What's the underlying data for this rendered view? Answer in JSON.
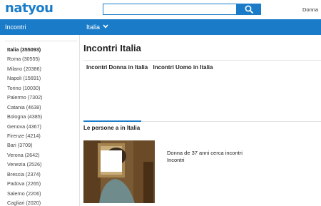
{
  "header": {
    "logo": "natyou",
    "search": {
      "value": "",
      "placeholder": ""
    },
    "user_link": "Donna"
  },
  "navbar": {
    "left_label": "Incontri",
    "region_label": "Italia"
  },
  "sidebar": {
    "cities": [
      {
        "label": "Italia (355093)",
        "active": true
      },
      {
        "label": "Roma (30555)"
      },
      {
        "label": "Milano (20386)"
      },
      {
        "label": "Napoli (15691)"
      },
      {
        "label": "Torino (10030)"
      },
      {
        "label": "Palermo (7302)"
      },
      {
        "label": "Catania (4638)"
      },
      {
        "label": "Bologna (4385)"
      },
      {
        "label": "Genova (4367)"
      },
      {
        "label": "Firenze (4214)"
      },
      {
        "label": "Bari (3709)"
      },
      {
        "label": "Verona (2642)"
      },
      {
        "label": "Venezia (2526)"
      },
      {
        "label": "Brescia (2374)"
      },
      {
        "label": "Padova (2265)"
      },
      {
        "label": "Salerno (2206)"
      },
      {
        "label": "Cagliari (2020)"
      }
    ]
  },
  "main": {
    "title": "Incontri Italia",
    "links": [
      "Incontri Donna in Italia",
      "Incontri Uomo in Italia"
    ],
    "section_title": "Le persone a in Italia",
    "profile": {
      "caption": "Donna de 37 anni cerca incontri Incontri"
    }
  },
  "colors": {
    "brand": "#1a7cc9",
    "text": "#222222",
    "border": "#e2e2e2"
  },
  "icons": {
    "search": "search-icon",
    "chevron": "chevron-down-icon"
  }
}
